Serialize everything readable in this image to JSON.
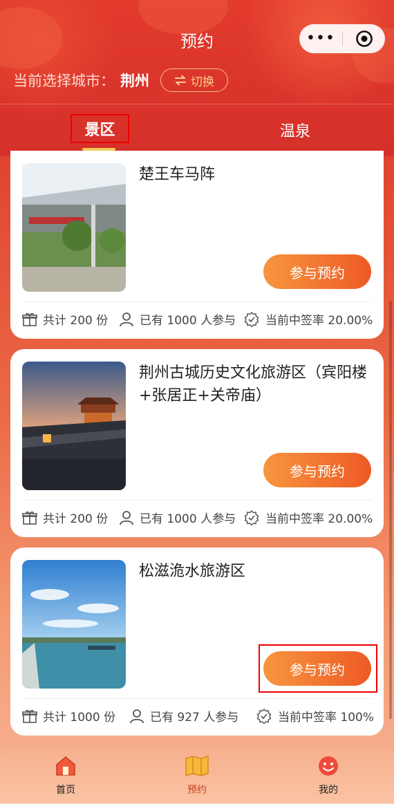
{
  "header": {
    "title": "预约",
    "city_label": "当前选择城市：",
    "city_name": "荆州",
    "switch_label": "切换"
  },
  "tabs": [
    {
      "label": "景区",
      "active": true
    },
    {
      "label": "温泉",
      "active": false
    }
  ],
  "cards": [
    {
      "name": "楚王车马阵",
      "book_label": "参与预约",
      "total": "共计 200 份",
      "joined": "已有 1000 人参与",
      "rate": "当前中签率 20.00%",
      "thumb_sign": "车马阵展厅"
    },
    {
      "name": "荆州古城历史文化旅游区（宾阳楼+张居正+关帝庙）",
      "book_label": "参与预约",
      "total": "共计 200 份",
      "joined": "已有 1000 人参与",
      "rate": "当前中签率 20.00%"
    },
    {
      "name": "松滋洈水旅游区",
      "book_label": "参与预约",
      "total": "共计 1000 份",
      "joined": "已有 927 人参与",
      "rate": "当前中签率 100%"
    }
  ],
  "tabbar": [
    {
      "label": "首页",
      "icon": "home-icon"
    },
    {
      "label": "预约",
      "icon": "map-icon",
      "active": true
    },
    {
      "label": "我的",
      "icon": "smile-icon"
    }
  ],
  "colors": {
    "accent_orange": "#ee5a26",
    "header_red": "#d9342a",
    "tab_underline": "#f7cc55",
    "switch_gold": "#f6c37a"
  }
}
